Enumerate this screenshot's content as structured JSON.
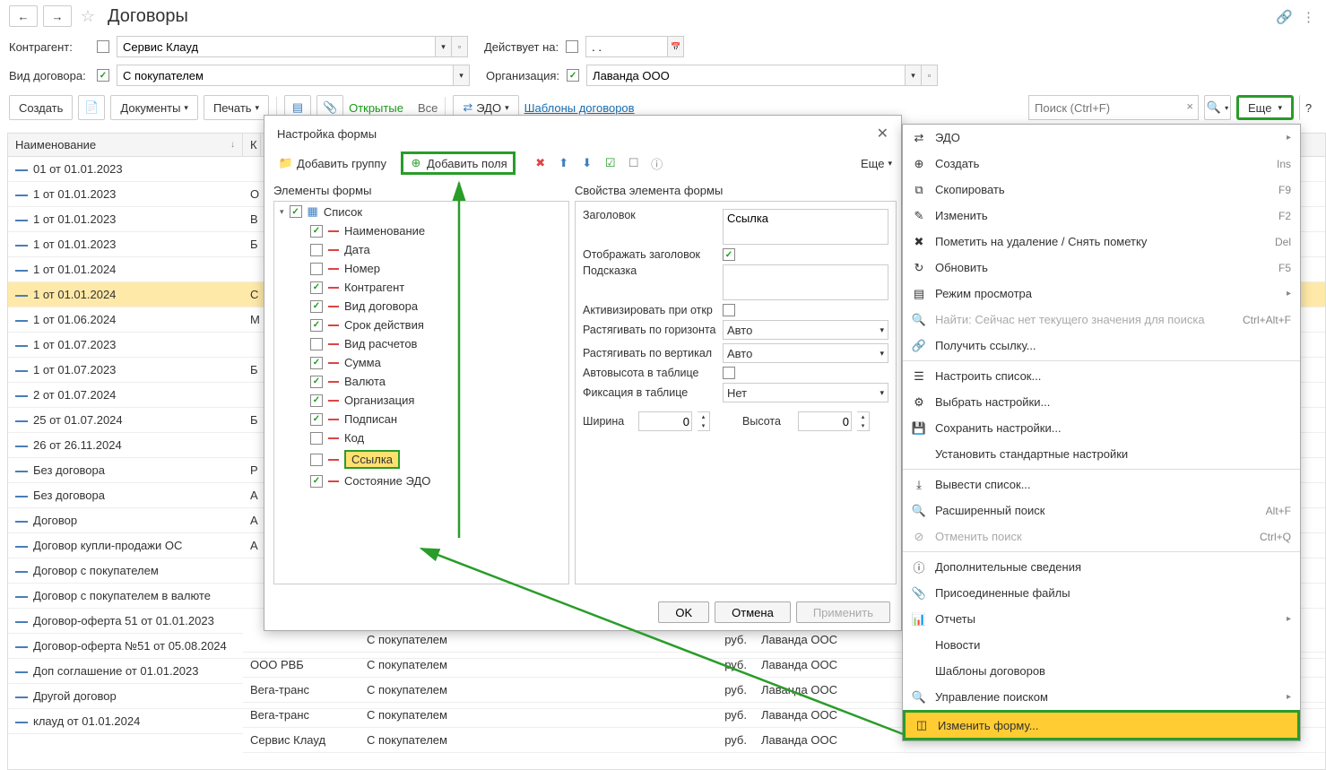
{
  "header": {
    "title": "Договоры"
  },
  "filters": {
    "counterparty_label": "Контрагент:",
    "counterparty_value": "Сервис Клауд",
    "effective_label": "Действует на:",
    "effective_value": ". .",
    "type_label": "Вид договора:",
    "type_value": "С покупателем",
    "org_label": "Организация:",
    "org_value": "Лаванда ООО"
  },
  "toolbar": {
    "create": "Создать",
    "documents": "Документы",
    "print": "Печать",
    "open": "Открытые",
    "all": "Все",
    "edo": "ЭДО",
    "templates": "Шаблоны договоров",
    "search_placeholder": "Поиск (Ctrl+F)",
    "more": "Еще",
    "help": "?"
  },
  "table": {
    "columns": {
      "name": "Наименование",
      "k": "К"
    },
    "rows": [
      {
        "name": "01 от 01.01.2023"
      },
      {
        "name": "1 от 01.01.2023",
        "k": "О"
      },
      {
        "name": "1 от 01.01.2023",
        "k": "В"
      },
      {
        "name": "1 от 01.01.2023",
        "k": "Б"
      },
      {
        "name": "1 от 01.01.2024"
      },
      {
        "name": "1 от 01.01.2024",
        "k": "С",
        "selected": true
      },
      {
        "name": "1 от 01.06.2024",
        "k": "М"
      },
      {
        "name": "1 от 01.07.2023"
      },
      {
        "name": "1 от 01.07.2023",
        "k": "Б"
      },
      {
        "name": "2 от 01.07.2024"
      },
      {
        "name": "25 от 01.07.2024",
        "k": "Б"
      },
      {
        "name": "26 от 26.11.2024"
      },
      {
        "name": "Без договора",
        "k": "Р"
      },
      {
        "name": "Без договора",
        "k": "А"
      },
      {
        "name": "Договор",
        "k": "А"
      },
      {
        "name": "Договор купли-продажи ОС",
        "k": "А"
      },
      {
        "name": "Договор с покупателем"
      },
      {
        "name": "Договор с покупателем в валюте"
      },
      {
        "name": "Договор-оферта 51 от 01.01.2023"
      },
      {
        "name": "Договор-оферта №51 от 05.08.2024"
      },
      {
        "name": "Доп соглашение от 01.01.2023"
      },
      {
        "name": "Другой договор"
      },
      {
        "name": "клауд от 01.01.2024"
      }
    ],
    "extra_rows": [
      {
        "org": "",
        "type": "С покупателем",
        "cur": "руб.",
        "comp": "Лаванда ООС"
      },
      {
        "org": "ООО РВБ",
        "type": "С покупателем",
        "cur": "руб.",
        "comp": "Лаванда ООС"
      },
      {
        "org": "Вега-транс",
        "type": "С покупателем",
        "cur": "руб.",
        "comp": "Лаванда ООС"
      },
      {
        "org": "Вега-транс",
        "type": "С покупателем",
        "cur": "руб.",
        "comp": "Лаванда ООС"
      },
      {
        "org": "Сервис Клауд",
        "type": "С покупателем",
        "cur": "руб.",
        "comp": "Лаванда ООС"
      }
    ]
  },
  "dialog": {
    "title": "Настройка формы",
    "add_group": "Добавить группу",
    "add_fields": "Добавить поля",
    "more": "Еще",
    "left_title": "Элементы формы",
    "right_title": "Свойства элемента формы",
    "tree_root": "Список",
    "tree_items": [
      {
        "label": "Наименование",
        "checked": true
      },
      {
        "label": "Дата",
        "checked": false
      },
      {
        "label": "Номер",
        "checked": false
      },
      {
        "label": "Контрагент",
        "checked": true
      },
      {
        "label": "Вид договора",
        "checked": true
      },
      {
        "label": "Срок действия",
        "checked": true
      },
      {
        "label": "Вид расчетов",
        "checked": false
      },
      {
        "label": "Сумма",
        "checked": true
      },
      {
        "label": "Валюта",
        "checked": true
      },
      {
        "label": "Организация",
        "checked": true
      },
      {
        "label": "Подписан",
        "checked": true
      },
      {
        "label": "Код",
        "checked": false
      },
      {
        "label": "Ссылка",
        "checked": false,
        "highlight": true
      },
      {
        "label": "Состояние ЭДО",
        "checked": true
      }
    ],
    "props": {
      "heading_label": "Заголовок",
      "heading_value": "Ссылка",
      "show_heading_label": "Отображать заголовок",
      "hint_label": "Подсказка",
      "activate_label": "Активизировать при откр",
      "hstretch_label": "Растягивать по горизонта",
      "hstretch_value": "Авто",
      "vstretch_label": "Растягивать по вертикал",
      "vstretch_value": "Авто",
      "autoheight_label": "Автовысота в таблице",
      "fixation_label": "Фиксация в таблице",
      "fixation_value": "Нет",
      "width_label": "Ширина",
      "width_value": "0",
      "height_label": "Высота",
      "height_value": "0"
    },
    "buttons": {
      "ok": "OK",
      "cancel": "Отмена",
      "apply": "Применить"
    }
  },
  "context_menu": {
    "items": [
      {
        "icon": "edo",
        "label": "ЭДО",
        "sub": true
      },
      {
        "icon": "plus",
        "label": "Создать",
        "shortcut": "Ins"
      },
      {
        "icon": "copy",
        "label": "Скопировать",
        "shortcut": "F9"
      },
      {
        "icon": "edit",
        "label": "Изменить",
        "shortcut": "F2"
      },
      {
        "icon": "mark",
        "label": "Пометить на удаление / Снять пометку",
        "shortcut": "Del"
      },
      {
        "icon": "refresh",
        "label": "Обновить",
        "shortcut": "F5"
      },
      {
        "icon": "view",
        "label": "Режим просмотра",
        "sub": true
      },
      {
        "icon": "find",
        "label": "Найти: Сейчас нет текущего значения для поиска",
        "shortcut": "Ctrl+Alt+F",
        "disabled": true
      },
      {
        "icon": "link",
        "label": "Получить ссылку..."
      },
      {
        "sep": true
      },
      {
        "icon": "list",
        "label": "Настроить список..."
      },
      {
        "icon": "pick",
        "label": "Выбрать настройки..."
      },
      {
        "icon": "save",
        "label": "Сохранить настройки..."
      },
      {
        "icon": "",
        "label": "Установить стандартные настройки"
      },
      {
        "sep": true
      },
      {
        "icon": "out",
        "label": "Вывести список..."
      },
      {
        "icon": "search",
        "label": "Расширенный поиск",
        "shortcut": "Alt+F"
      },
      {
        "icon": "cancel",
        "label": "Отменить поиск",
        "shortcut": "Ctrl+Q",
        "disabled": true
      },
      {
        "sep": true
      },
      {
        "icon": "info",
        "label": "Дополнительные сведения"
      },
      {
        "icon": "attach",
        "label": "Присоединенные файлы"
      },
      {
        "icon": "report",
        "label": "Отчеты",
        "sub": true
      },
      {
        "icon": "",
        "label": "Новости"
      },
      {
        "icon": "",
        "label": "Шаблоны договоров"
      },
      {
        "icon": "search2",
        "label": "Управление поиском",
        "sub": true
      },
      {
        "icon": "form",
        "label": "Изменить форму...",
        "highlight": true
      }
    ]
  }
}
